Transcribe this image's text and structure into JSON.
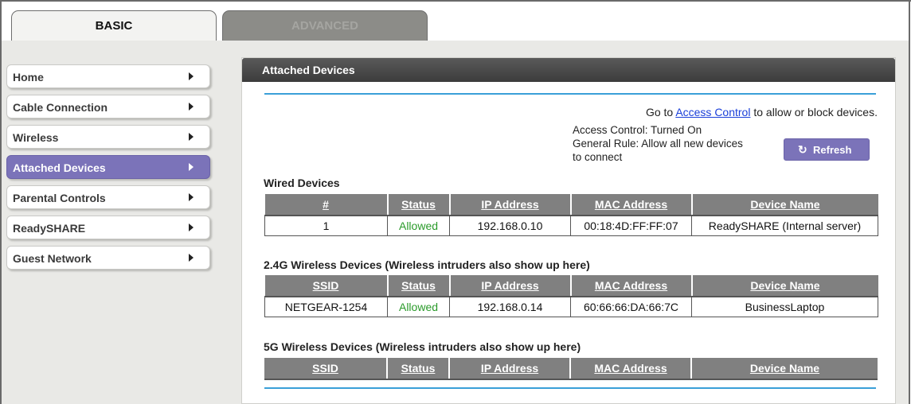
{
  "tabs": {
    "basic": "BASIC",
    "advanced": "ADVANCED"
  },
  "sidebar": {
    "items": [
      {
        "label": "Home",
        "active": false
      },
      {
        "label": "Cable Connection",
        "active": false
      },
      {
        "label": "Wireless",
        "active": false
      },
      {
        "label": "Attached Devices",
        "active": true
      },
      {
        "label": "Parental Controls",
        "active": false
      },
      {
        "label": "ReadySHARE",
        "active": false
      },
      {
        "label": "Guest Network",
        "active": false
      }
    ]
  },
  "panel": {
    "title": "Attached Devices",
    "goto_prefix": "Go to ",
    "goto_link": "Access Control",
    "goto_suffix": " to allow or block devices.",
    "access_control_status": "Access Control: Turned On",
    "general_rule": "General Rule: Allow all new devices to connect",
    "refresh_label": "Refresh",
    "refresh_icon": "refresh-icon"
  },
  "wired": {
    "title": "Wired Devices",
    "columns": [
      "#",
      "Status",
      "IP Address",
      "MAC Address",
      "Device Name"
    ],
    "rows": [
      [
        "1",
        "Allowed",
        "192.168.0.10",
        "00:18:4D:FF:FF:07",
        "ReadySHARE (Internal server)"
      ]
    ]
  },
  "wireless24": {
    "title": "2.4G Wireless Devices (Wireless intruders also show up here)",
    "columns": [
      "SSID",
      "Status",
      "IP Address",
      "MAC Address",
      "Device Name"
    ],
    "rows": [
      [
        "NETGEAR-1254",
        "Allowed",
        "192.168.0.14",
        "60:66:66:DA:66:7C",
        "BusinessLaptop"
      ]
    ]
  },
  "wireless5": {
    "title": "5G Wireless Devices (Wireless intruders also show up here)",
    "columns": [
      "SSID",
      "Status",
      "IP Address",
      "MAC Address",
      "Device Name"
    ],
    "rows": []
  },
  "colors": {
    "accent": "#7b73b9",
    "header_dark": "#4a4a4a",
    "allowed_green": "#2a9a2a",
    "rule_blue": "#3aa0d8"
  }
}
